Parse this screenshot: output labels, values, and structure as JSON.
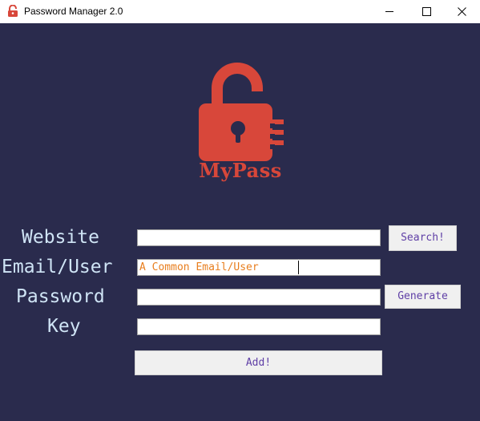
{
  "window": {
    "title": "Password Manager 2.0",
    "icon": "lock-icon",
    "controls": [
      "minimize-icon",
      "maximize-icon",
      "close-icon"
    ]
  },
  "logo": {
    "text": "MyPass",
    "icon": "unlocked-padlock-icon",
    "color": "#d8473a"
  },
  "form": {
    "website_label": "Website",
    "email_label": "Email/User",
    "password_label": "Password",
    "key_label": "Key",
    "website_value": "",
    "email_value": "A Common Email/User",
    "password_value": "",
    "key_value": ""
  },
  "buttons": {
    "search_label": "Search!",
    "generate_label": "Generate",
    "add_label": "Add!"
  },
  "colors": {
    "background": "#2a2b4d",
    "label_text": "#cfe4f5",
    "entry_text": "#e87e1e",
    "button_text": "#5f3fa6"
  }
}
